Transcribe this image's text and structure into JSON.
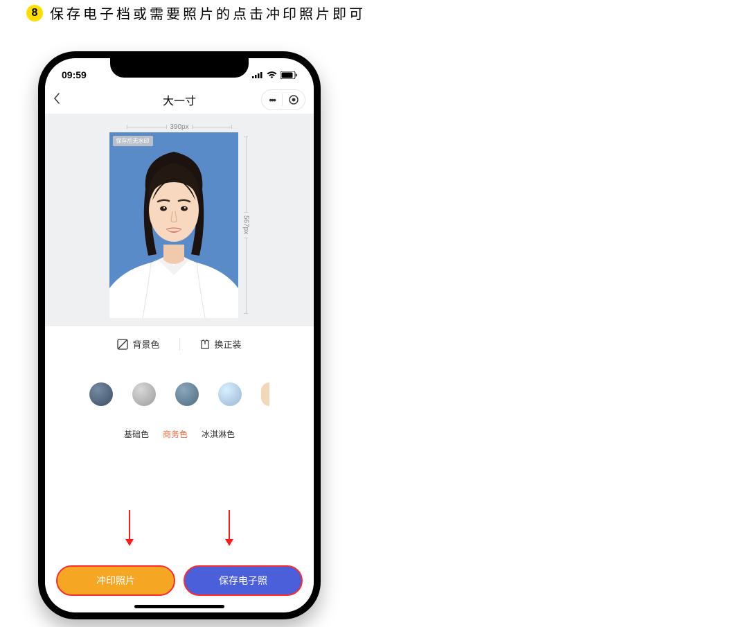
{
  "header": {
    "step_number": "8",
    "instruction": "保存电子档或需要照片的点击冲印照片即可"
  },
  "status_bar": {
    "time": "09:59"
  },
  "nav": {
    "title": "大一寸"
  },
  "photo": {
    "width_label": "390px",
    "height_label": "567px",
    "watermark_tag": "保存后无水印"
  },
  "tabs": {
    "bg_label": "背景色",
    "outfit_label": "换正装"
  },
  "colors": [
    {
      "hex": "#3a4e66"
    },
    {
      "hex": "#9c9c9c"
    },
    {
      "hex": "#4f6b80"
    },
    {
      "hex": "#9bb4d4"
    }
  ],
  "partial_color": {
    "hex": "#f2d8b8"
  },
  "categories": [
    {
      "label": "基础色",
      "active": false
    },
    {
      "label": "商务色",
      "active": true
    },
    {
      "label": "冰淇淋色",
      "active": false
    }
  ],
  "buttons": {
    "print": "冲印照片",
    "save": "保存电子照"
  }
}
